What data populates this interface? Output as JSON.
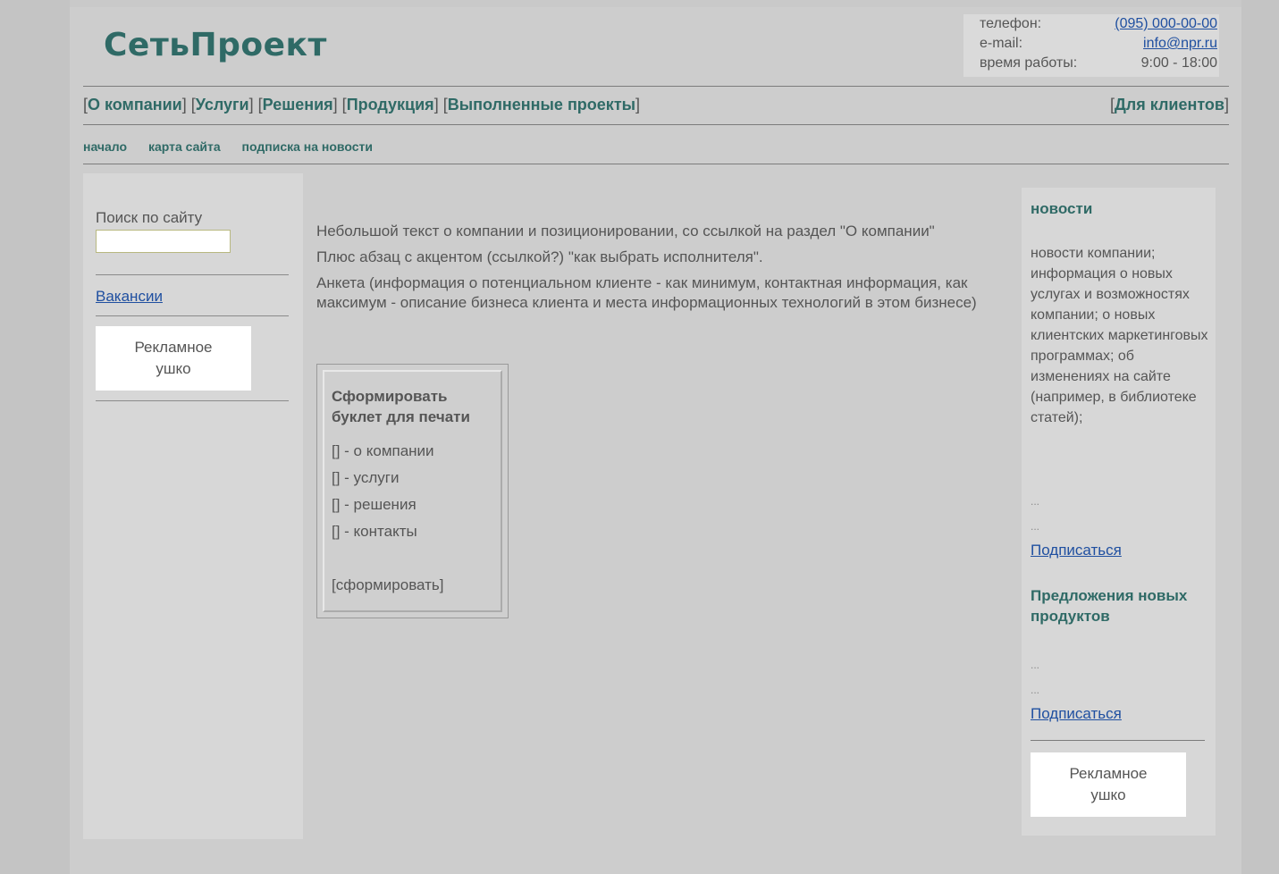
{
  "header": {
    "logo": "СетьПроект",
    "contact": {
      "phone_label": "телефон:",
      "phone_value": "(095) 000-00-00",
      "email_label": "e-mail:",
      "email_value": "info@npr.ru",
      "hours_label": "время работы:",
      "hours_value": "9:00 - 18:00"
    }
  },
  "topnav": {
    "items": [
      {
        "label": "О компании"
      },
      {
        "label": "Услуги"
      },
      {
        "label": "Решения"
      },
      {
        "label": "Продукция"
      },
      {
        "label": "Выполненные проекты"
      }
    ],
    "right_item": "Для клиентов"
  },
  "subnav": {
    "items": [
      "начало",
      "карта сайта",
      "подписка на новости"
    ]
  },
  "left": {
    "search_label": "Поиск по сайту",
    "search_value": "",
    "vacancy_link": "Вакансии",
    "ad_line1": "Рекламное",
    "ad_line2": "ушко"
  },
  "main": {
    "para1": "Небольшой текст о компании и позиционировании, со ссылкой на раздел \"О компании\"",
    "para2": "Плюс абзац с акцентом (ссылкой?) \"как выбрать исполнителя\".",
    "para3": "Анкета (информация о потенциальном клиенте - как минимум, контактная информация, как максимум - описание бизнеса клиента и места информационных технологий в этом бизнесе)",
    "booklet": {
      "title_line1": "Сформировать",
      "title_line2": "буклет для печати",
      "options": [
        "[] - о компании",
        "[] - услуги",
        "[] - решения",
        "[] - контакты"
      ],
      "submit": "[сформировать]"
    }
  },
  "right": {
    "news_heading": "новости",
    "news_text": "новости компании; информация о новых услугах и возможностях компании; о новых клиентских маркетинговых программах; об изменениях на сайте (например, в библиотеке статей);",
    "dots": "...",
    "subscribe1": "Подписаться",
    "offers_heading": "Предложения новых продуктов",
    "subscribe2": "Подписаться",
    "ad_line1": "Рекламное",
    "ad_line2": "ушко"
  }
}
